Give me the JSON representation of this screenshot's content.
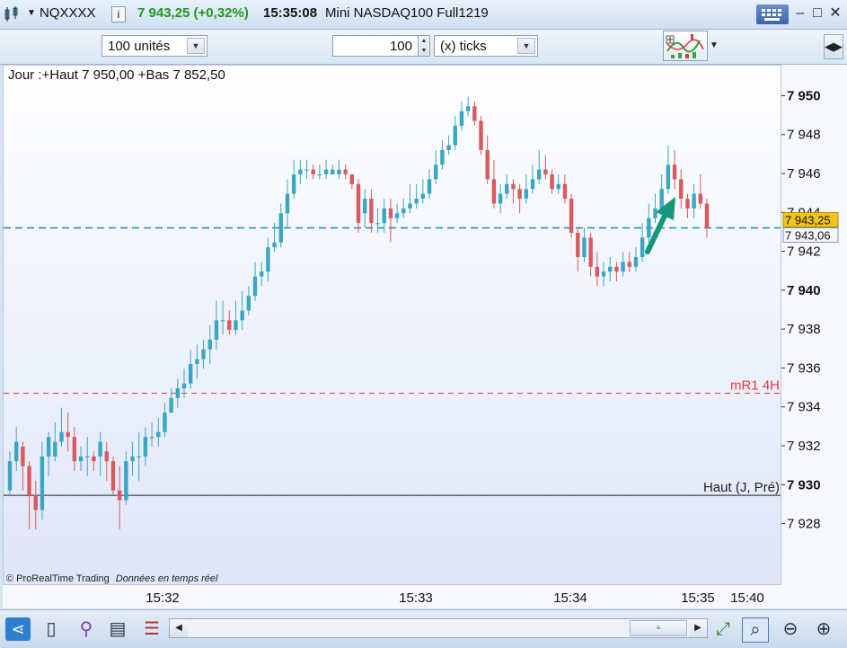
{
  "window": {
    "symbol": "NQXXXX",
    "info_icon": "i",
    "price_change": "7 943,25 (+0,32%)",
    "time": "15:35:08",
    "instrument": "Mini NASDAQ100 Full1219",
    "up_color": "#3aa6c6",
    "down_color": "#d9595f"
  },
  "toolbar": {
    "units_select": "100 unités",
    "ticks_value": "100",
    "ticks_select": "(x) ticks"
  },
  "chart_header": "Jour :+Haut 7 950,00 +Bas 7 852,50",
  "watermark": "© ProRealTime Trading",
  "realtime_note": "Données en temps réel",
  "chart_data": {
    "type": "candlestick",
    "ylim": [
      7926.5,
      7951.5
    ],
    "y_ticks": [
      {
        "value": 7950,
        "label": "7 950",
        "bold": true
      },
      {
        "value": 7948,
        "label": "7 948",
        "bold": false
      },
      {
        "value": 7946,
        "label": "7 946",
        "bold": false
      },
      {
        "value": 7944,
        "label": "7 944",
        "bold": false
      },
      {
        "value": 7942,
        "label": "7 942",
        "bold": false
      },
      {
        "value": 7940,
        "label": "7 940",
        "bold": true
      },
      {
        "value": 7938,
        "label": "7 938",
        "bold": false
      },
      {
        "value": 7936,
        "label": "7 936",
        "bold": false
      },
      {
        "value": 7934,
        "label": "7 934",
        "bold": false
      },
      {
        "value": 7932,
        "label": "7 932",
        "bold": false
      },
      {
        "value": 7930,
        "label": "7 930",
        "bold": true
      },
      {
        "value": 7928,
        "label": "7 928",
        "bold": false
      }
    ],
    "x_labels": [
      "15:32",
      "15:33",
      "15:34",
      "15:35",
      "15:40"
    ],
    "last_price": {
      "value": 7943.25,
      "label": "7 943,25"
    },
    "mid_price": {
      "value": 7943.06,
      "label": "7 943,06"
    },
    "levels": [
      {
        "value": 7943.25,
        "label": "",
        "style": "dashed",
        "color": "#1f97b0"
      },
      {
        "value": 7934.75,
        "label": "mR1 4H",
        "style": "dashed",
        "color": "#e23a3a"
      },
      {
        "value": 7929.5,
        "label": "Haut (J, Pré)",
        "style": "solid",
        "color": "#222222"
      }
    ],
    "candles": [
      [
        7929.75,
        7931.25,
        7931.75,
        7929.5
      ],
      [
        7931.25,
        7932.25,
        7933,
        7930.75
      ],
      [
        7932,
        7931,
        7932.25,
        7929.75
      ],
      [
        7931,
        7929.5,
        7931.25,
        7927.75
      ],
      [
        7929.5,
        7928.75,
        7930.25,
        7927.75
      ],
      [
        7928.75,
        7931.5,
        7932.25,
        7928.25
      ],
      [
        7931.5,
        7932.5,
        7932.75,
        7930.5
      ],
      [
        7931.5,
        7932.25,
        7933.25,
        7931.25
      ],
      [
        7932.25,
        7932.75,
        7934,
        7932
      ],
      [
        7932.75,
        7932.5,
        7933.75,
        7931.75
      ],
      [
        7932.5,
        7931.25,
        7933,
        7930.75
      ],
      [
        7931.25,
        7931.5,
        7932,
        7930.75
      ],
      [
        7931.5,
        7931.5,
        7932.5,
        7930.5
      ],
      [
        7931.5,
        7931.25,
        7931.75,
        7930.75
      ],
      [
        7931.5,
        7932.25,
        7932.75,
        7930.5
      ],
      [
        7931.75,
        7931.25,
        7932.25,
        7930.25
      ],
      [
        7931.25,
        7929.75,
        7931.5,
        7929.5
      ],
      [
        7929.75,
        7929.25,
        7931,
        7927.75
      ],
      [
        7929.25,
        7931.25,
        7931.75,
        7929
      ],
      [
        7931.25,
        7931.5,
        7932.25,
        7930.5
      ],
      [
        7931.5,
        7931.5,
        7932.75,
        7930.25
      ],
      [
        7931.5,
        7932.5,
        7933,
        7931
      ],
      [
        7932.5,
        7932.5,
        7933.25,
        7932
      ],
      [
        7932.5,
        7932.75,
        7933.5,
        7932
      ],
      [
        7932.75,
        7933.75,
        7934.25,
        7932.5
      ],
      [
        7933.75,
        7934.5,
        7935,
        7933.75
      ],
      [
        7934.5,
        7935,
        7935.5,
        7934
      ],
      [
        7935,
        7935.25,
        7936,
        7934.5
      ],
      [
        7935.25,
        7936.25,
        7937,
        7935
      ],
      [
        7936.25,
        7936.5,
        7937.25,
        7935.5
      ],
      [
        7936.5,
        7937,
        7937.5,
        7936
      ],
      [
        7937,
        7937.5,
        7938.25,
        7936.25
      ],
      [
        7937.5,
        7938.5,
        7939.5,
        7937
      ],
      [
        7938.5,
        7938.5,
        7939.5,
        7937.75
      ],
      [
        7938.5,
        7938,
        7939,
        7937.75
      ],
      [
        7938,
        7938.5,
        7939.5,
        7937.75
      ],
      [
        7938.5,
        7939,
        7940,
        7938
      ],
      [
        7939,
        7939.75,
        7940.25,
        7938.75
      ],
      [
        7939.75,
        7940.75,
        7941.5,
        7939.5
      ],
      [
        7940.75,
        7941,
        7941.5,
        7940.25
      ],
      [
        7941,
        7942.25,
        7942.75,
        7940.5
      ],
      [
        7942.25,
        7942.5,
        7943.5,
        7942
      ],
      [
        7942.5,
        7944,
        7944.5,
        7942.25
      ],
      [
        7944,
        7945,
        7945.75,
        7943.25
      ],
      [
        7945,
        7946,
        7946.75,
        7944.75
      ],
      [
        7946,
        7946.25,
        7946.75,
        7945.5
      ],
      [
        7946.25,
        7946.25,
        7946.75,
        7945.75
      ],
      [
        7946.25,
        7946,
        7946.5,
        7945.75
      ],
      [
        7946,
        7946,
        7946.5,
        7945.75
      ],
      [
        7946,
        7946.25,
        7946.75,
        7945.75
      ],
      [
        7946,
        7946.25,
        7946.5,
        7946
      ],
      [
        7946,
        7946.25,
        7946.75,
        7945.75
      ],
      [
        7946.25,
        7946,
        7946.5,
        7945.75
      ],
      [
        7946,
        7945.5,
        7946,
        7945.25
      ],
      [
        7945.5,
        7943.5,
        7945.75,
        7943
      ],
      [
        7944,
        7944.75,
        7945.25,
        7943.25
      ],
      [
        7944.75,
        7943.5,
        7945.25,
        7943
      ],
      [
        7943.5,
        7943.5,
        7944.25,
        7943
      ],
      [
        7943.5,
        7944.25,
        7944.75,
        7943
      ],
      [
        7944.25,
        7943.75,
        7944.75,
        7942.5
      ],
      [
        7943.75,
        7944,
        7944.5,
        7943.5
      ],
      [
        7944,
        7944.25,
        7944.75,
        7943.75
      ],
      [
        7944.25,
        7944.5,
        7945.5,
        7944
      ],
      [
        7944.5,
        7944.75,
        7945.5,
        7944.25
      ],
      [
        7944.75,
        7945,
        7945.75,
        7944.5
      ],
      [
        7945,
        7945.75,
        7946.25,
        7944.75
      ],
      [
        7945.75,
        7946.5,
        7947.25,
        7945.5
      ],
      [
        7946.5,
        7947.25,
        7947.75,
        7946.25
      ],
      [
        7947.25,
        7947.5,
        7948,
        7947
      ],
      [
        7947.5,
        7948.5,
        7949,
        7947.25
      ],
      [
        7948.5,
        7949.25,
        7949.75,
        7948.25
      ],
      [
        7949.25,
        7949.5,
        7950,
        7949
      ],
      [
        7949.5,
        7948.75,
        7949.75,
        7948.5
      ],
      [
        7948.75,
        7947.25,
        7949,
        7947
      ],
      [
        7947.25,
        7945.75,
        7948,
        7945.5
      ],
      [
        7945.75,
        7944.5,
        7946.75,
        7944.25
      ],
      [
        7944.5,
        7945,
        7945.5,
        7944
      ],
      [
        7945,
        7945.5,
        7946,
        7944.75
      ],
      [
        7945.5,
        7945.25,
        7945.75,
        7944.5
      ],
      [
        7945.25,
        7944.75,
        7945.5,
        7944
      ],
      [
        7944.75,
        7945.25,
        7946,
        7944.5
      ],
      [
        7945.25,
        7945.75,
        7946.5,
        7945
      ],
      [
        7945.75,
        7946.25,
        7947.25,
        7945.5
      ],
      [
        7946.25,
        7946,
        7947,
        7945.75
      ],
      [
        7946,
        7945.25,
        7946.25,
        7945
      ],
      [
        7945.25,
        7945.5,
        7946,
        7945
      ],
      [
        7945.5,
        7944.75,
        7946,
        7944.5
      ],
      [
        7944.75,
        7943,
        7945,
        7942.75
      ],
      [
        7943,
        7941.75,
        7943.25,
        7941
      ],
      [
        7941.75,
        7942.75,
        7943.25,
        7941.5
      ],
      [
        7942.75,
        7941.25,
        7943,
        7940.75
      ],
      [
        7941.25,
        7940.75,
        7942,
        7940.25
      ],
      [
        7940.75,
        7941,
        7941.5,
        7940.25
      ],
      [
        7941,
        7941.25,
        7941.75,
        7940.5
      ],
      [
        7941.25,
        7941,
        7941.5,
        7940.5
      ],
      [
        7941,
        7941.5,
        7942,
        7940.75
      ],
      [
        7941.5,
        7941.25,
        7942,
        7941
      ],
      [
        7941.25,
        7941.75,
        7942.25,
        7941
      ],
      [
        7941.75,
        7942.75,
        7943.5,
        7941.5
      ],
      [
        7942.75,
        7943.75,
        7944.5,
        7942.5
      ],
      [
        7943.75,
        7944.25,
        7945,
        7943.5
      ],
      [
        7944.25,
        7945.25,
        7946,
        7944
      ],
      [
        7945.25,
        7946.5,
        7947.5,
        7945
      ],
      [
        7946.5,
        7945.75,
        7947.25,
        7945.25
      ],
      [
        7945.75,
        7944.75,
        7946.25,
        7944.25
      ],
      [
        7944.75,
        7944.25,
        7945,
        7943.75
      ],
      [
        7944.25,
        7945,
        7945.5,
        7943.75
      ],
      [
        7945,
        7944.5,
        7946,
        7944.25
      ],
      [
        7944.5,
        7943.25,
        7944.75,
        7942.75
      ]
    ]
  }
}
